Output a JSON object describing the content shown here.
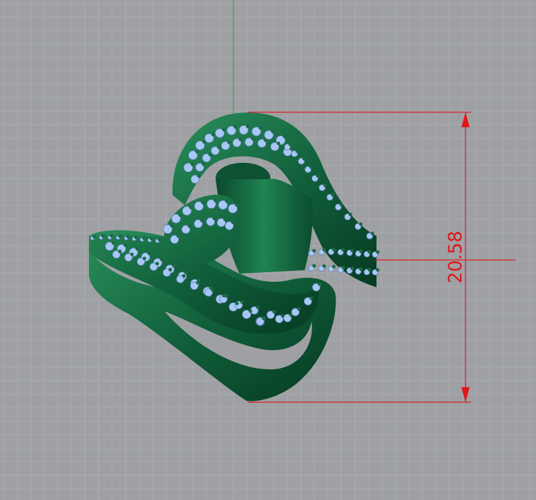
{
  "viewport": {
    "background_color": "#9ea0a4",
    "grid_minor_color": "#a9abaf",
    "grid_major_color": "#8e9094",
    "axis_color": "#2fae3a"
  },
  "model": {
    "name": "ring",
    "metal_color": "#11603b",
    "metal_highlight": "#2a8f5c",
    "metal_shadow": "#063a22",
    "stone_color": "#a8c8f4",
    "prong_color": "#1b6a46"
  },
  "dimension": {
    "value_text": "20.58",
    "color": "#e0161b"
  }
}
